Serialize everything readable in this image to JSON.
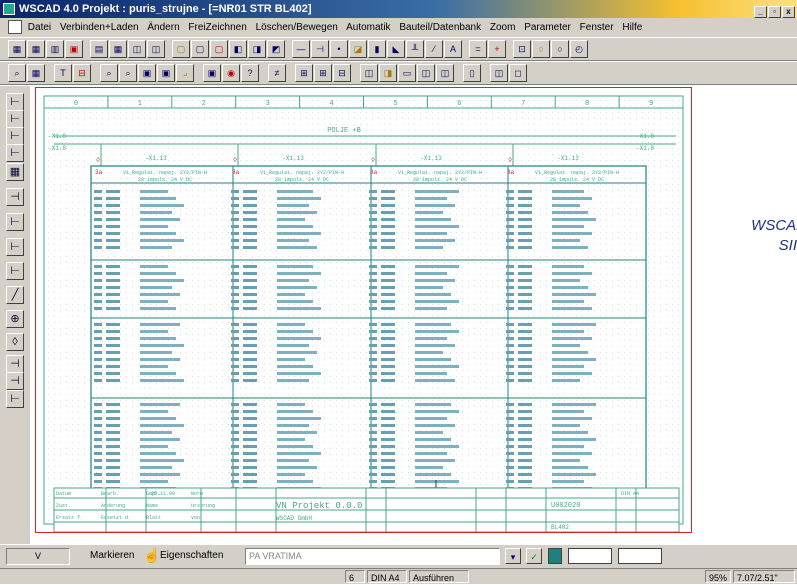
{
  "window": {
    "title": "WSCAD 4.0   Projekt : puris_strujne - [=NR01  STR  BL402]",
    "min": "_",
    "max": "▫",
    "close": "x"
  },
  "menu": [
    "Datei",
    "Verbinden+Laden",
    "Ändern",
    "FreiZeichnen",
    "Löschen/Bewegen",
    "Automatik",
    "Bauteil/Datenbank",
    "Zoom",
    "Parameter",
    "Fenster",
    "Hilfe"
  ],
  "toolbar1": [
    "▦",
    "▦",
    "▥",
    "▣",
    "▤",
    "▦",
    "◫",
    "◫",
    "▢",
    "▢",
    "▢",
    "◧",
    "◨",
    "◩",
    "—",
    "⊣",
    "•",
    "◪",
    "▮",
    "◣",
    "╨",
    "⁄",
    "A",
    "=",
    "+",
    "⊡",
    "○",
    "○",
    "◴"
  ],
  "toolbar2": [
    "⌕",
    "▦",
    "T",
    "⊟",
    "⌕",
    "⌕",
    "▣",
    "▣",
    "⟓",
    "▣",
    "◉",
    "?",
    "≠",
    "⊞",
    "⊞",
    "⊟",
    "◫",
    "◨",
    "▭",
    "◫",
    "◫",
    "▯",
    "◫",
    "◻"
  ],
  "sidebar": [
    "⊢",
    "⊢",
    "⊢",
    "⊢",
    "▦",
    "⊣",
    "⊢",
    "⊢",
    "⊢",
    "╱",
    "⊕",
    "◊",
    "⊣",
    "⊣",
    "⊢"
  ],
  "sheet": {
    "header_label": "POLJE +B",
    "left_labels": [
      "-X1.8",
      "-X1.8"
    ],
    "right_labels": [
      "-X1.8",
      "-X1.8"
    ],
    "columns": [
      "0",
      "1",
      "2",
      "3",
      "4",
      "5",
      "6",
      "7",
      "8",
      "9"
    ],
    "col_titles": [
      "-X1.13",
      "-X1.13",
      "-X1.13",
      "-X1.13"
    ],
    "blocks": [
      {
        "tag": "3a",
        "title1": "V1_Regulat. napaj. 2Y2/PIN-H",
        "title2": "28 impuls. 24 V DC"
      },
      {
        "tag": "3a",
        "title1": "V1_Regulat. napaj. 2Y2/PIN-H",
        "title2": "28 impuls. 24 V DC"
      },
      {
        "tag": "3a",
        "title1": "V1_Regulat. napaj. 2Y2/PIN-H",
        "title2": "28 impuls. 24 V DC"
      },
      {
        "tag": "3a",
        "title1": "V1_Regulat. napaj. 2Y2/PIN-H",
        "title2": "28 impuls. 24 V DC"
      }
    ],
    "titleblock": {
      "project": "VN Projekt 0.0.0",
      "company": "WSCAD GmbH",
      "date": "25.11.99",
      "norm": "DIN A4",
      "sheet": "BL402",
      "drawing": "U002020",
      "cells": [
        "Datum",
        "Bearb.",
        "Gepr.",
        "Norm",
        "Zust.",
        "Änderung",
        "Name",
        "Ursprung",
        "Ersatz f.",
        "Ersetzt d.",
        "Blatt",
        "von"
      ]
    }
  },
  "side_text": [
    "WSCAD",
    "SII"
  ],
  "bottom": {
    "left_label": "V",
    "markieren": "Markieren",
    "eigenschaften": "Eigenschaften",
    "input_value": "PA VRATIMA"
  },
  "status": {
    "left": "6",
    "norm": "DIN A4",
    "mode": "Ausführen",
    "zoom": "95%",
    "coords": "7.07/2.51\""
  },
  "colors": {
    "sheet_border": "#dd2222",
    "grid": "#44aa88",
    "accent": "#0a246a"
  }
}
